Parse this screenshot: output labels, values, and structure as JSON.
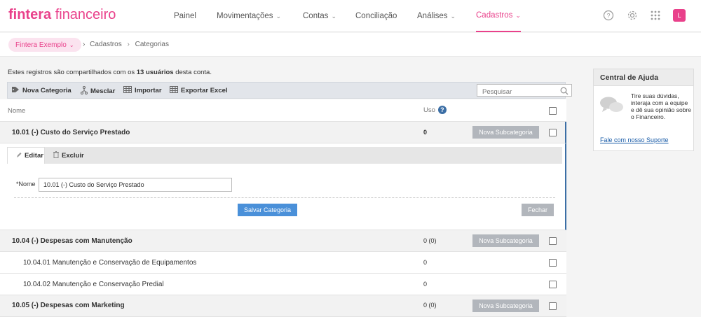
{
  "app": {
    "logo_bold": "fintera",
    "logo_rest": "financeiro"
  },
  "nav": {
    "items": [
      {
        "label": "Painel",
        "has_dropdown": false
      },
      {
        "label": "Movimentações",
        "has_dropdown": true
      },
      {
        "label": "Contas",
        "has_dropdown": true
      },
      {
        "label": "Conciliação",
        "has_dropdown": false
      },
      {
        "label": "Análises",
        "has_dropdown": true
      },
      {
        "label": "Cadastros",
        "has_dropdown": true,
        "active": true
      }
    ],
    "chevron": "⌄",
    "help_icon": "?",
    "settings_icon": "⚙",
    "apps_icon": "⠿",
    "user_initial": "L"
  },
  "breadcrumb": {
    "company": "Fintera Exemplo",
    "items": [
      "Cadastros",
      "Categorias"
    ],
    "separator": "›"
  },
  "info": {
    "prefix": "Estes registros são compartilhados com os",
    "count": "13 usuários",
    "suffix": "desta conta."
  },
  "toolbar": {
    "nova_categoria": "Nova Categoria",
    "mesclar": "Mesclar",
    "importar": "Importar",
    "exportar": "Exportar Excel",
    "search_placeholder": "Pesquisar"
  },
  "table": {
    "col_nome": "Nome",
    "col_uso": "Uso",
    "rows": [
      {
        "type": "category",
        "name": "10.01 (-) Custo do Serviço Prestado",
        "uso": "0",
        "action": "Nova Subcategoria"
      },
      {
        "type": "category",
        "name": "10.04 (-) Despesas com Manutenção",
        "uso": "0 (0)",
        "action": "Nova Subcategoria"
      },
      {
        "type": "subcategory",
        "name": "10.04.01 Manutenção e Conservação de Equipamentos",
        "uso": "0"
      },
      {
        "type": "subcategory",
        "name": "10.04.02 Manutenção e Conservação Predial",
        "uso": "0"
      },
      {
        "type": "category",
        "name": "10.05 (-) Despesas com Marketing",
        "uso": "0 (0)",
        "action": "Nova Subcategoria"
      }
    ]
  },
  "edit": {
    "tab_edit": "Editar",
    "tab_delete": "Excluir",
    "field_label": "*Nome",
    "field_value": "10.01 (-) Custo do Serviço Prestado",
    "save": "Salvar Categoria",
    "close": "Fechar"
  },
  "help": {
    "title": "Central de Ajuda",
    "text": "Tire suas dúvidas, interaja com a equipe e dê sua opinião sobre o Financeiro.",
    "link": "Fale com nosso Suporte"
  },
  "colors": {
    "brand": "#e9418b",
    "accent_blue": "#3b6ea5",
    "button_grey": "#b2b6bc",
    "save_blue": "#4a90d9"
  }
}
